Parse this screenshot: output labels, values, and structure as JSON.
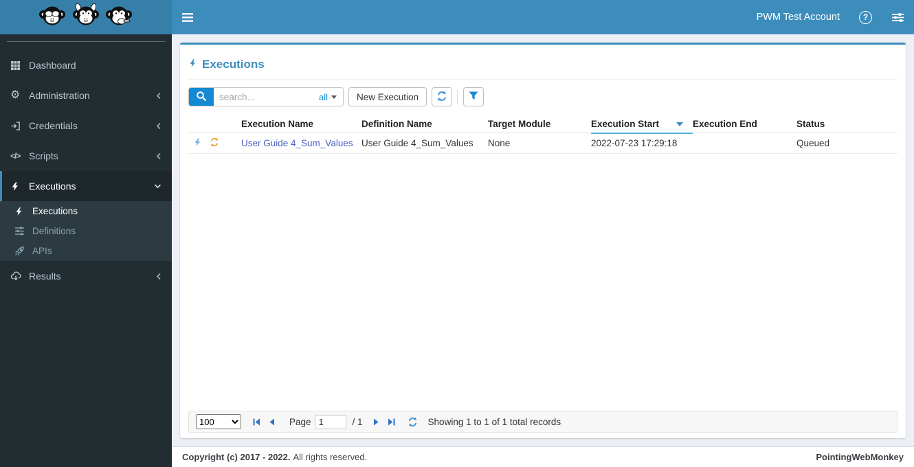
{
  "topbar": {
    "account": "PWM Test Account"
  },
  "sidebar": {
    "items": [
      {
        "label": "Dashboard",
        "icon": "grid-icon"
      },
      {
        "label": "Administration",
        "icon": "gears-icon",
        "chevron": "left"
      },
      {
        "label": "Credentials",
        "icon": "sign-in-icon",
        "chevron": "left"
      },
      {
        "label": "Scripts",
        "icon": "code-icon",
        "chevron": "left"
      },
      {
        "label": "Executions",
        "icon": "bolt-icon",
        "chevron": "down",
        "active": true,
        "children": [
          {
            "label": "Executions",
            "icon": "bolt-icon",
            "active": true
          },
          {
            "label": "Definitions",
            "icon": "sliders-icon"
          },
          {
            "label": "APIs",
            "icon": "rocket-icon"
          }
        ]
      },
      {
        "label": "Results",
        "icon": "cloud-download-icon",
        "chevron": "left"
      }
    ]
  },
  "main": {
    "title": "Executions",
    "toolbar": {
      "search_placeholder": "search...",
      "search_scope": "all",
      "new_execution": "New Execution"
    },
    "table": {
      "columns": [
        "Execution Name",
        "Definition Name",
        "Target Module",
        "Execution Start",
        "Execution End",
        "Status"
      ],
      "sort": {
        "column": "Execution Start",
        "direction": "desc"
      },
      "rows": [
        {
          "execution_name": "User Guide 4_Sum_Values",
          "definition_name": "User Guide 4_Sum_Values",
          "target_module": "None",
          "execution_start": "2022-07-23 17:29:18",
          "execution_end": "",
          "status": "Queued"
        }
      ]
    },
    "pagination": {
      "page_size": "100",
      "page_label": "Page",
      "page_value": "1",
      "page_total": "/ 1",
      "summary": "Showing 1 to 1 of 1 total records"
    }
  },
  "footer": {
    "copyright": "Copyright (c) 2017 - 2022.",
    "rights": "All rights reserved.",
    "brand": "PointingWebMonkey"
  },
  "colors": {
    "navbar": "#3c8dbc",
    "logo_bg": "#367fa9",
    "sidebar_bg": "#222d32",
    "submenu_bg": "#2c3b41",
    "active_border": "#3c8dbc",
    "accent_blue": "#1589d1",
    "sort_underline": "#55b5dd",
    "link": "#4a5fc0",
    "row_bolt": "#74b3e3",
    "row_refresh": "#f0a33c",
    "pagination_arrows": "#2e74c9"
  }
}
